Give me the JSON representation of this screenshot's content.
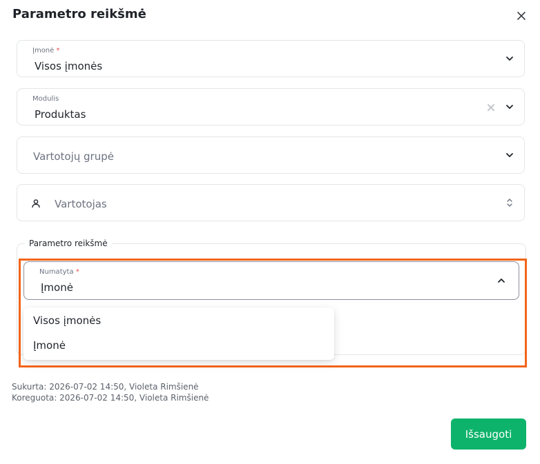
{
  "dialog": {
    "title": "Parametro reikšmė"
  },
  "fields": {
    "company": {
      "label": "Įmonė",
      "required": "*",
      "value": "Visos įmonės"
    },
    "module": {
      "label": "Modulis",
      "value": "Produktas"
    },
    "user_group": {
      "placeholder": "Vartotojų grupė"
    },
    "user": {
      "placeholder": "Vartotojas"
    }
  },
  "param_value": {
    "legend": "Parametro reikšmė",
    "select": {
      "label": "Numatyta",
      "required": "*",
      "value": "Įmonė"
    },
    "options": [
      "Visos įmonės",
      "Įmonė"
    ]
  },
  "meta": {
    "created": "Sukurta: 2026-07-02 14:50, Violeta Rimšienė",
    "updated": "Koreguota: 2026-07-02 14:50, Violeta Rimšienė"
  },
  "actions": {
    "save_label": "Išsaugoti"
  },
  "colors": {
    "accent": "#0db36b",
    "highlight": "#f26419",
    "required": "#e5484d"
  }
}
